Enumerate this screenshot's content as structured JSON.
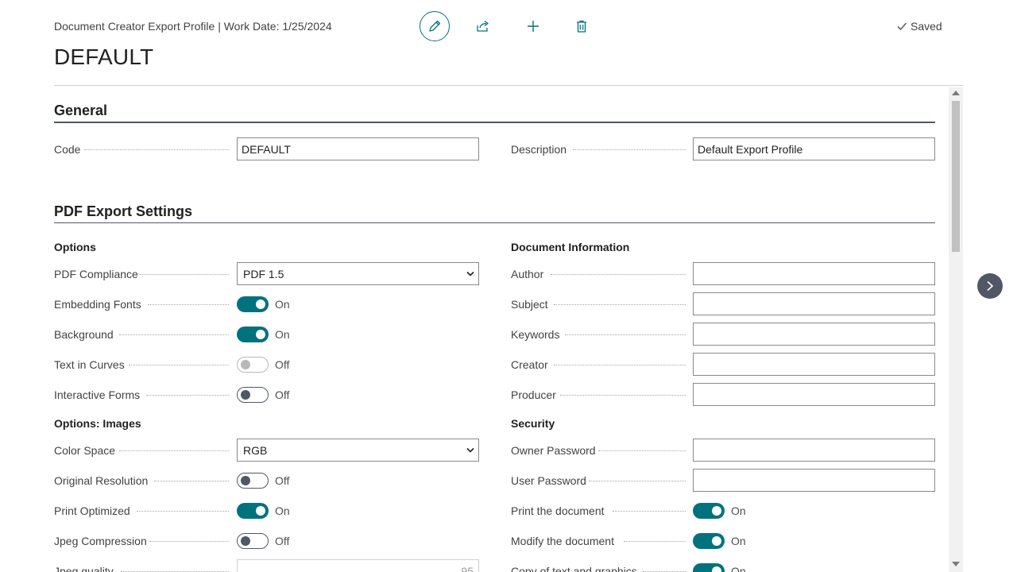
{
  "header": {
    "breadcrumb": "Document Creator Export Profile | Work Date: 1/25/2024",
    "title": "DEFAULT",
    "saved_label": "Saved",
    "actions": [
      "edit-icon",
      "share-icon",
      "plus-icon",
      "delete-icon"
    ]
  },
  "general": {
    "title": "General",
    "code_label": "Code",
    "code_value": "DEFAULT",
    "description_label": "Description",
    "description_value": "Default Export Profile"
  },
  "pdf": {
    "title": "PDF Export Settings",
    "options_title": "Options",
    "pdf_compliance_label": "PDF Compliance",
    "pdf_compliance_value": "PDF 1.5",
    "embedding_fonts_label": "Embedding Fonts",
    "embedding_fonts_state": "On",
    "background_label": "Background",
    "background_state": "On",
    "text_in_curves_label": "Text in Curves",
    "text_in_curves_state": "Off",
    "interactive_forms_label": "Interactive Forms",
    "interactive_forms_state": "Off",
    "images_title": "Options: Images",
    "color_space_label": "Color Space",
    "color_space_value": "RGB",
    "original_resolution_label": "Original Resolution",
    "original_resolution_state": "Off",
    "print_optimized_label": "Print Optimized",
    "print_optimized_state": "On",
    "jpeg_compression_label": "Jpeg Compression",
    "jpeg_compression_state": "Off",
    "jpeg_quality_label": "Jpeg quality",
    "jpeg_quality_value": "95",
    "doc_info_title": "Document Information",
    "author_label": "Author",
    "subject_label": "Subject",
    "keywords_label": "Keywords",
    "creator_label": "Creator",
    "producer_label": "Producer",
    "security_title": "Security",
    "owner_password_label": "Owner Password",
    "user_password_label": "User Password",
    "print_document_label": "Print the document",
    "print_document_state": "On",
    "modify_document_label": "Modify the document",
    "modify_document_state": "On",
    "copy_text_label": "Copy of text and graphics",
    "copy_text_state": "On"
  },
  "colors": {
    "accent": "#00727d",
    "toggle_off": "#505866",
    "border": "#8a8a8a"
  }
}
